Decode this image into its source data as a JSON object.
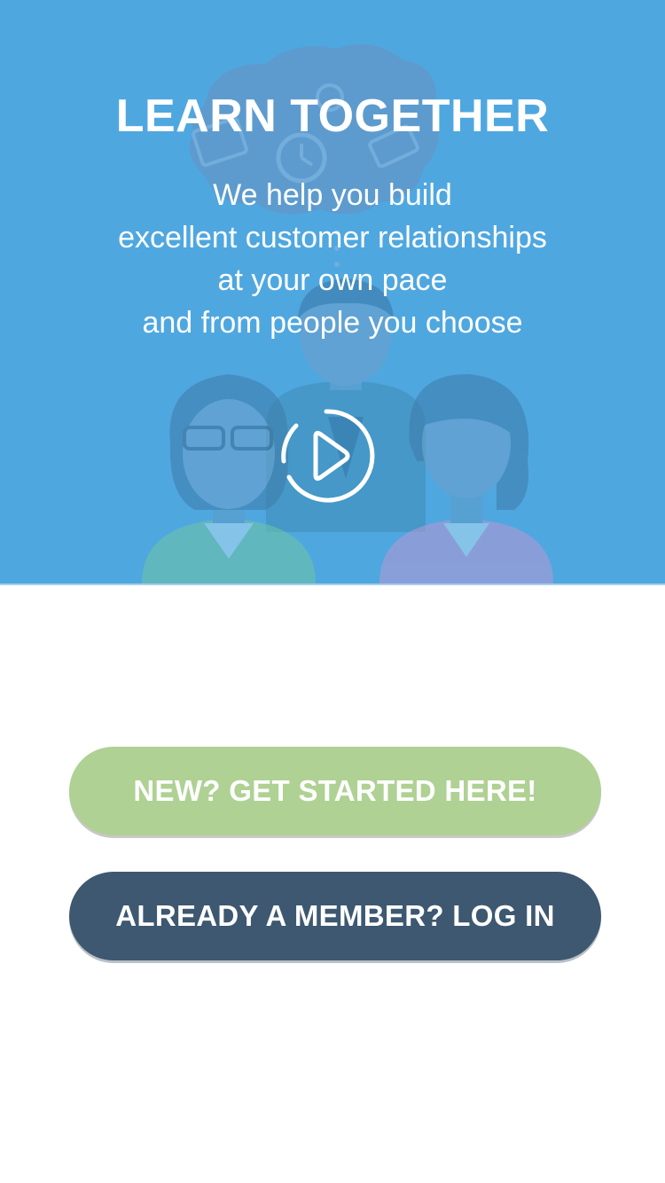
{
  "hero": {
    "title": "LEARN TOGETHER",
    "tagline": [
      "We help you build",
      "excellent customer relationships",
      "at your own pace",
      "and from people you choose"
    ],
    "play_icon": "play-circle-icon",
    "background_color": "#4fa7e0"
  },
  "actions": {
    "get_started_label": "NEW? GET STARTED HERE!",
    "login_label": "ALREADY A MEMBER? LOG IN",
    "get_started_color": "#afd193",
    "login_color": "#3d5870"
  }
}
